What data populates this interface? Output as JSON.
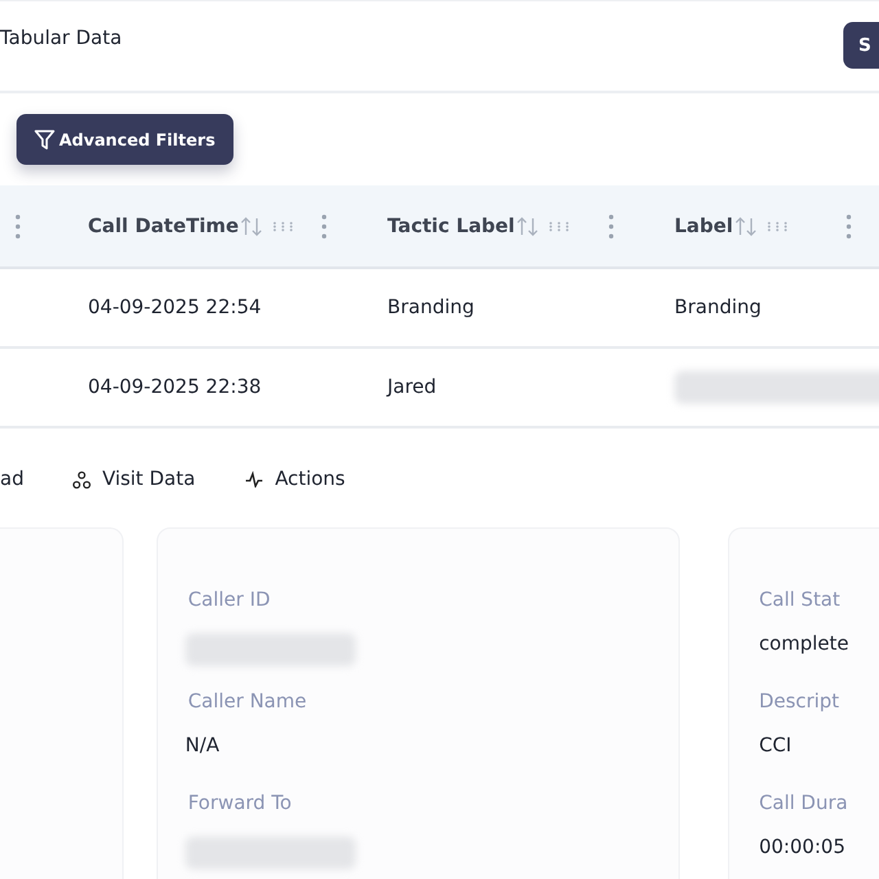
{
  "header": {
    "title": "Tabular Data",
    "button": "S"
  },
  "filters_button": "Advanced Filters",
  "table": {
    "columns": [
      {},
      {
        "label": "Call DateTime"
      },
      {
        "label": "Tactic Label"
      },
      {
        "label": "Label"
      }
    ],
    "rows": [
      {
        "cells": [
          {},
          {
            "text": "04-09-2025 22:54"
          },
          {
            "text": "Branding"
          },
          {
            "text": "Branding"
          }
        ]
      },
      {
        "cells": [
          {},
          {
            "text": "04-09-2025 22:38"
          },
          {
            "text": "Jared"
          },
          {
            "redacted": true
          }
        ]
      }
    ]
  },
  "tabs": [
    {
      "kind": "plain",
      "label": "ad"
    },
    {
      "kind": "visit",
      "label": "Visit Data"
    },
    {
      "kind": "actions",
      "label": "Actions"
    }
  ],
  "cards": [
    {
      "fields": [
        {
          "label": "Caller ID",
          "redacted": true
        },
        {
          "label": "Caller Name",
          "value": "N/A"
        },
        {
          "label": "Forward To",
          "redacted": true
        }
      ]
    },
    {
      "fields": [
        {
          "label": "Call Stat",
          "value": "complete"
        },
        {
          "label": "Descript",
          "value": "CCI"
        },
        {
          "label": "Call Dura",
          "value": "00:00:05"
        }
      ]
    }
  ]
}
